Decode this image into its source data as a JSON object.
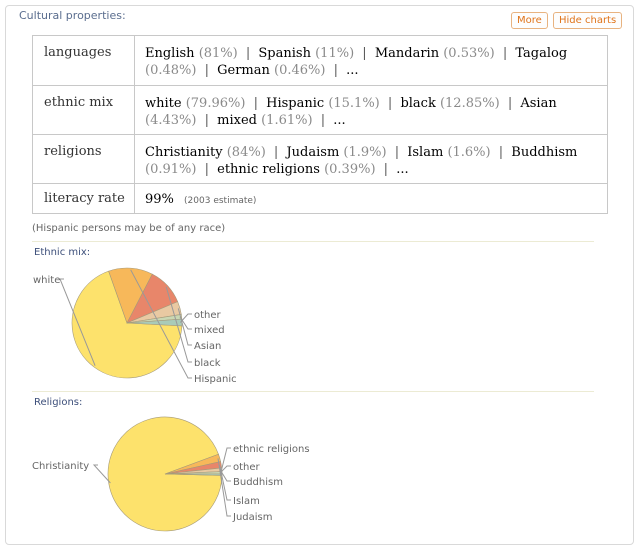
{
  "header": {
    "title": "Cultural properties:",
    "more_label": "More",
    "hide_charts_label": "Hide charts"
  },
  "properties": {
    "languages": {
      "label": "languages",
      "items": [
        {
          "name": "English",
          "pct": "(81%)"
        },
        {
          "name": "Spanish",
          "pct": "(11%)"
        },
        {
          "name": "Mandarin",
          "pct": "(0.53%)"
        },
        {
          "name": "Tagalog",
          "pct": "(0.48%)"
        },
        {
          "name": "German",
          "pct": "(0.46%)"
        }
      ]
    },
    "ethnic_mix": {
      "label": "ethnic mix",
      "items": [
        {
          "name": "white",
          "pct": "(79.96%)"
        },
        {
          "name": "Hispanic",
          "pct": "(15.1%)"
        },
        {
          "name": "black",
          "pct": "(12.85%)"
        },
        {
          "name": "Asian",
          "pct": "(4.43%)"
        },
        {
          "name": "mixed",
          "pct": "(1.61%)"
        }
      ]
    },
    "religions": {
      "label": "religions",
      "items": [
        {
          "name": "Christianity",
          "pct": "(84%)"
        },
        {
          "name": "Judaism",
          "pct": "(1.9%)"
        },
        {
          "name": "Islam",
          "pct": "(1.6%)"
        },
        {
          "name": "Buddhism",
          "pct": "(0.91%)"
        },
        {
          "name": "ethnic religions",
          "pct": "(0.39%)"
        }
      ]
    },
    "literacy": {
      "label": "literacy rate",
      "value": "99%",
      "note": "(2003 estimate)"
    },
    "separator": "|",
    "ellipsis": "..."
  },
  "footnote": "(Hispanic persons may be of any race)",
  "ethnic_chart": {
    "title": "Ethnic mix:",
    "slice_labels": [
      "white",
      "Hispanic",
      "black",
      "Asian",
      "mixed",
      "other"
    ]
  },
  "religion_chart": {
    "title": "Religions:",
    "slice_labels": [
      "Christianity",
      "Judaism",
      "Islam",
      "Buddhism",
      "other",
      "ethnic religions"
    ]
  },
  "chart_data": [
    {
      "type": "pie",
      "title": "Ethnic mix:",
      "labels": [
        "white",
        "Hispanic",
        "black",
        "Asian",
        "mixed",
        "other"
      ],
      "values": [
        66.0,
        12.5,
        10.6,
        3.7,
        1.3,
        1.9
      ],
      "colors": [
        "#fde26c",
        "#f7b85a",
        "#e8866a",
        "#e9c9a2",
        "#cad7b3",
        "#a9cbb9"
      ]
    },
    {
      "type": "pie",
      "title": "Religions:",
      "labels": [
        "Christianity",
        "Judaism",
        "Islam",
        "Buddhism",
        "other",
        "ethnic religions"
      ],
      "values": [
        84,
        1.9,
        1.6,
        0.91,
        0.6,
        0.39
      ],
      "colors": [
        "#fde26c",
        "#f7b85a",
        "#e8866a",
        "#e9c9a2",
        "#cad7b3",
        "#a9cbb9"
      ]
    }
  ]
}
